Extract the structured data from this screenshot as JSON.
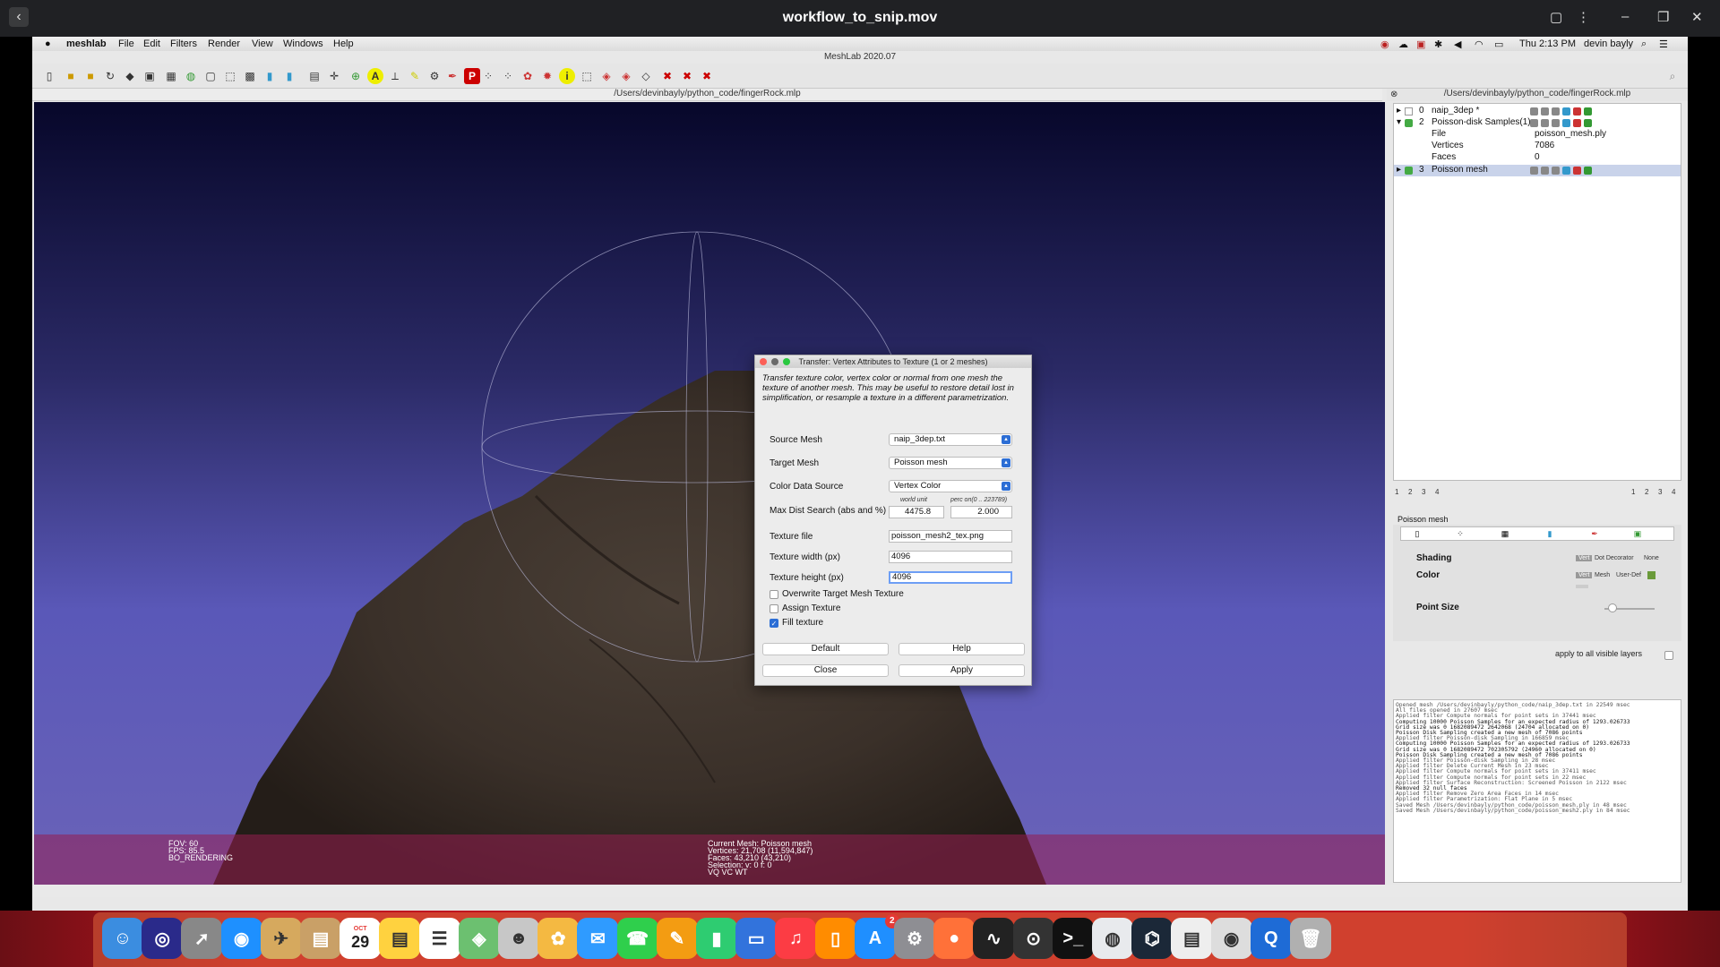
{
  "player": {
    "title": "workflow_to_snip.mov"
  },
  "menubar": {
    "items": [
      "meshlab",
      "File",
      "Edit",
      "Filters",
      "Render",
      "View",
      "Windows",
      "Help"
    ],
    "clock": "Thu 2:13 PM",
    "user": "devin bayly"
  },
  "app": {
    "title": "MeshLab 2020.07",
    "doc_path": "/Users/devinbayly/python_code/fingerRock.mlp"
  },
  "viewport": {
    "overlay_left": [
      "FOV: 60",
      "FPS:   85.5",
      "BO_RENDERING"
    ],
    "overlay_center": [
      "Current Mesh: Poisson mesh",
      "Vertices: 21,708    (11,594,847)",
      "Faces: 43,210    (43,210)",
      "Selection: v: 0 f: 0",
      "VQ VC WT"
    ]
  },
  "dialog": {
    "title": "Transfer: Vertex Attributes to Texture (1 or 2 meshes)",
    "description": "Transfer texture color, vertex color or normal from one mesh the texture of another mesh. This may be useful to restore detail lost in simplification, or resample a texture in a different parametrization.",
    "source_mesh_label": "Source Mesh",
    "source_mesh_value": "naip_3dep.txt",
    "target_mesh_label": "Target Mesh",
    "target_mesh_value": "Poisson mesh",
    "color_source_label": "Color Data Source",
    "color_source_value": "Vertex Color",
    "max_dist_label": "Max Dist Search (abs and %)",
    "world_unit_caption": "world unit",
    "perc_caption": "perc on(0 .. 223789)",
    "max_dist_abs": "4475.8",
    "max_dist_perc": "2.000",
    "texture_file_label": "Texture file",
    "texture_file_value": "poisson_mesh2_tex.png",
    "texture_width_label": "Texture width (px)",
    "texture_width_value": "4096",
    "texture_height_label": "Texture height (px)",
    "texture_height_value": "4096",
    "overwrite_label": "Overwrite Target Mesh Texture",
    "overwrite_checked": false,
    "assign_label": "Assign Texture",
    "assign_checked": false,
    "fill_label": "Fill texture",
    "fill_checked": true,
    "default_button": "Default",
    "help_button": "Help",
    "close_button": "Close",
    "apply_button": "Apply"
  },
  "right_panel": {
    "project_path": "/Users/devinbayly/python_code/fingerRock.mlp",
    "layers": [
      {
        "id": "0",
        "name": "naip_3dep *"
      },
      {
        "id": "2",
        "name": "Poisson-disk Samples(1)"
      },
      {
        "id": "3",
        "name": "Poisson mesh"
      }
    ],
    "layer_details": [
      {
        "key": "File",
        "value": "poisson_mesh.ply"
      },
      {
        "key": "Vertices",
        "value": "7086"
      },
      {
        "key": "Faces",
        "value": "0"
      }
    ],
    "pager_left": [
      "1",
      "2",
      "3",
      "4"
    ],
    "pager_right": [
      "1",
      "2",
      "3",
      "4"
    ],
    "decorator_title": "Poisson mesh",
    "shading_label": "Shading",
    "shading_options": [
      "Vert",
      "Dot Decorator",
      "None"
    ],
    "color_label": "Color",
    "color_options": [
      "Vert",
      "Mesh",
      "User-Def"
    ],
    "point_size_label": "Point Size",
    "apply_all_label": "apply to all visible layers"
  },
  "log": [
    "Opened mesh /Users/devinbayly/python_code/naip_3dep.txt in 22549 msec",
    "All files opened in 27607 msec",
    "Applied filter Compute normals for point sets in 37441 msec",
    "Computing 10000 Poisson Samples for an expected radius of 1293.026733",
    "Grid size was 0 1682089472 2642068 (24704 allocated on 0)",
    "Poisson Disk Sampling created a new mesh of 7086 points",
    "Applied filter Poisson-disk Sampling in 166859 msec",
    "Computing 10000 Poisson Samples for an expected radius of 1293.026733",
    "Grid size was 0 1682089472 702305792 (24960 allocated on 0)",
    "Poisson Disk Sampling created a new mesh of 7086 points",
    "Applied filter Poisson-disk Sampling in 28 msec",
    "Applied filter Delete Current Mesh in 23 msec",
    "Applied filter Compute normals for point sets in 37411 msec",
    "Applied filter Compute normals for point sets in 22 msec",
    "Applied filter Surface Reconstruction: Screened Poisson in 2122 msec",
    "Removed 32 null faces",
    "Applied filter Remove Zero Area Faces in 14 msec",
    "Applied filter Parametrization: Flat Plane in 5 msec",
    "Saved Mesh /Users/devinbayly/python_code/poisson_mesh.ply in 48 msec",
    "Saved Mesh /Users/devinbayly/python_code/poisson_mesh2.ply in 84 msec"
  ],
  "dock": {
    "calendar_month": "OCT",
    "calendar_day": "29",
    "appstore_badge": "2",
    "apps": [
      "finder-icon",
      "siri-icon",
      "launchpad-icon",
      "safari-icon",
      "preview-icon",
      "notes-brown-icon",
      "calendar-icon",
      "notes-icon",
      "reminders-icon",
      "maps-icon",
      "meshlab-icon",
      "photos-icon",
      "messages-icon",
      "facetime-icon",
      "pages-icon",
      "numbers-icon",
      "keynote-icon",
      "music-icon",
      "books-icon",
      "appstore-icon",
      "settings-icon",
      "firefox-icon",
      "activity-icon",
      "obs-icon",
      "terminal-icon",
      "chrome-icon",
      "steam-icon",
      "textedit-icon",
      "eye-icon",
      "quicktime-icon",
      "trash-icon"
    ]
  },
  "colors": {
    "accent": "#2c6ed5",
    "dock_bg": "#c0141e",
    "viewport_sky": "#5a58b8",
    "rock": "#3a3029"
  }
}
